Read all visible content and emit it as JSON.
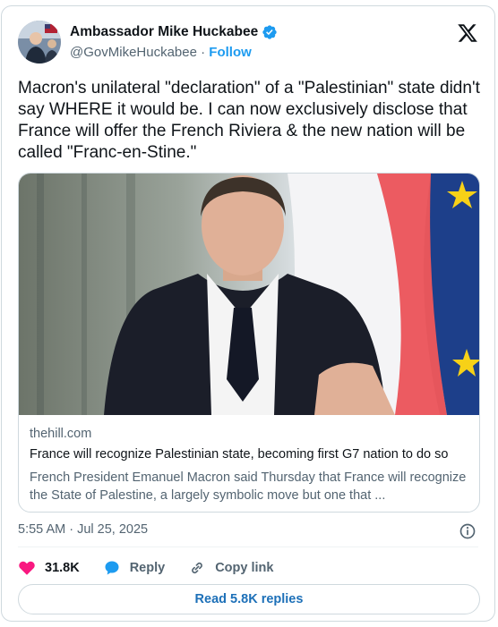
{
  "author": {
    "display_name": "Ambassador Mike Huckabee",
    "handle": "@GovMikeHuckabee",
    "separator": "·",
    "follow_label": "Follow",
    "verified_icon": "verified-badge-icon"
  },
  "tweet": {
    "text": "Macron's unilateral \"declaration\" of a \"Palestinian\" state didn't say WHERE it would be. I can now exclusively disclose that France will offer the French Riviera & the new nation will be called \"Franc-en-Stine.\""
  },
  "link_card": {
    "domain": "thehill.com",
    "title": "France will recognize Palestinian state, becoming first G7 nation to do so",
    "description": "French President Emanuel Macron said Thursday that France will recognize the State of Palestine, a largely symbolic move but one that ..."
  },
  "meta": {
    "timestamp": "5:55 AM · Jul 25, 2025"
  },
  "actions": {
    "like_count": "31.8K",
    "reply_label": "Reply",
    "copy_link_label": "Copy link"
  },
  "read_replies_label": "Read 5.8K replies",
  "colors": {
    "accent": "#1d9bf0",
    "like": "#f91880",
    "text": "#0f1419",
    "muted": "#536471",
    "border": "#cfd9de"
  }
}
